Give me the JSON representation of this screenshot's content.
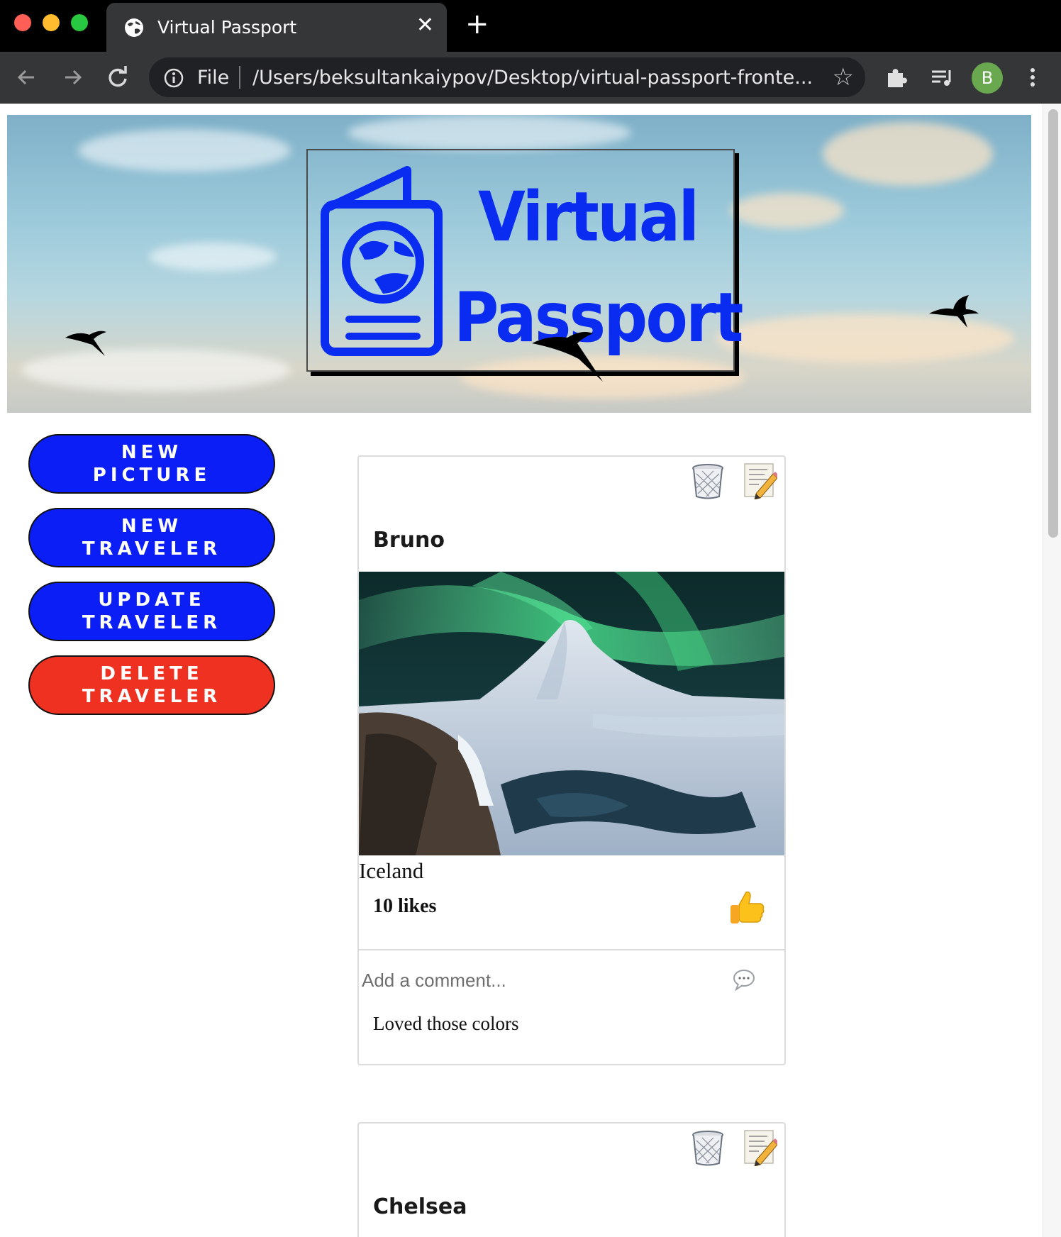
{
  "browser": {
    "tab_title": "Virtual Passport",
    "new_tab_symbol": "+",
    "close_symbol": "✕",
    "omnibox_scheme": "File",
    "omnibox_url": "/Users/beksultankaiypov/Desktop/virtual-passport-fronte...",
    "profile_initial": "B"
  },
  "banner": {
    "logo_line1": "Virtual",
    "logo_line2": "Passport",
    "logo_color": "#0a2cf0"
  },
  "sidebar": {
    "buttons": [
      {
        "line1": "NEW",
        "line2": "PICTURE",
        "color": "#0a1ef5"
      },
      {
        "line1": "NEW",
        "line2": "TRAVELER",
        "color": "#0a1ef5"
      },
      {
        "line1": "UPDATE",
        "line2": "TRAVELER",
        "color": "#0a1ef5"
      },
      {
        "line1": "DELETE",
        "line2": "TRAVELER",
        "color": "#ef3122"
      }
    ]
  },
  "cards": [
    {
      "name": "Bruno",
      "place": "Iceland",
      "likes": "10 likes",
      "comment_placeholder": "Add a comment...",
      "comments": [
        "Loved those colors"
      ]
    },
    {
      "name": "Chelsea"
    }
  ],
  "icons": {
    "trash": "trash-icon",
    "edit": "edit-icon",
    "like": "thumbs-up-icon",
    "comment": "speech-bubble-icon"
  }
}
